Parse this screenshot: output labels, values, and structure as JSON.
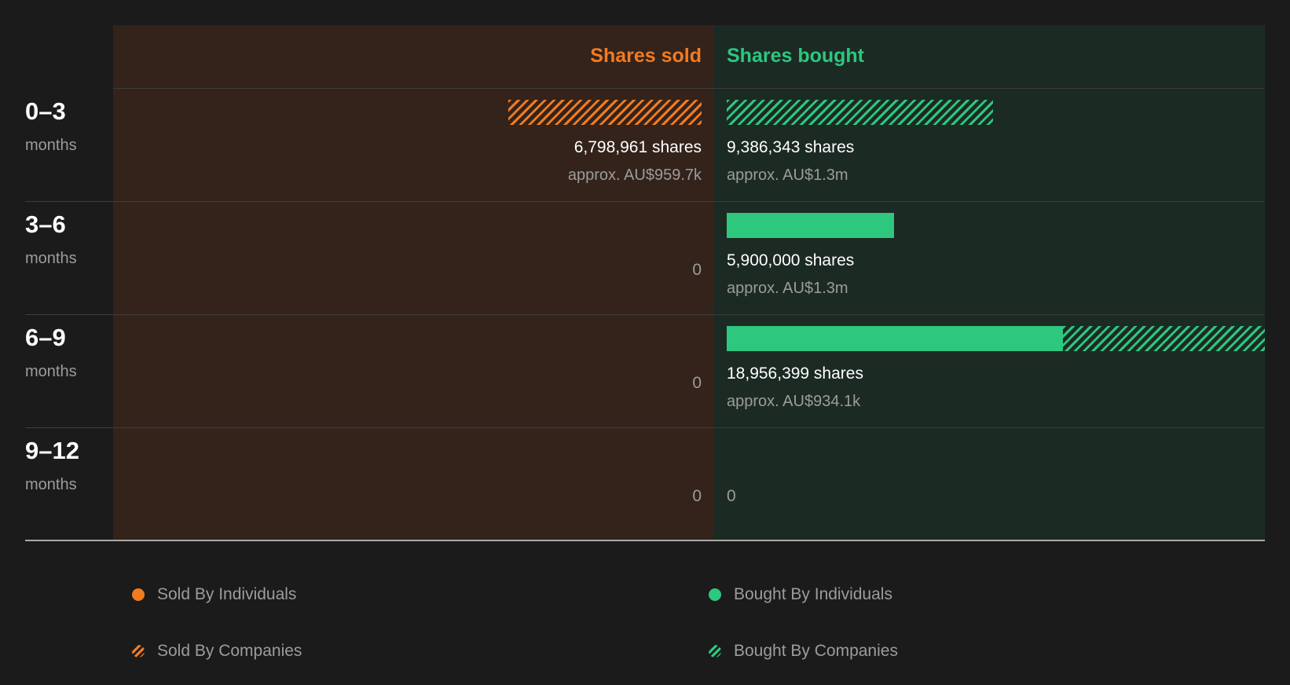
{
  "chart_data": {
    "type": "bar",
    "headers": {
      "sold": "Shares sold",
      "bought": "Shares bought"
    },
    "periods": [
      {
        "range": "0–3",
        "unit": "months",
        "sold": {
          "individuals": 0,
          "companies": 6798961,
          "shares_label": "6,798,961 shares",
          "approx": "approx. AU$959.7k",
          "zero_label": ""
        },
        "bought": {
          "individuals": 0,
          "companies": 9386343,
          "shares_label": "9,386,343 shares",
          "approx": "approx. AU$1.3m",
          "zero_label": ""
        }
      },
      {
        "range": "3–6",
        "unit": "months",
        "sold": {
          "individuals": 0,
          "companies": 0,
          "shares_label": "",
          "approx": "",
          "zero_label": "0"
        },
        "bought": {
          "individuals": 5900000,
          "companies": 0,
          "shares_label": "5,900,000 shares",
          "approx": "approx. AU$1.3m",
          "zero_label": ""
        }
      },
      {
        "range": "6–9",
        "unit": "months",
        "sold": {
          "individuals": 0,
          "companies": 0,
          "shares_label": "",
          "approx": "",
          "zero_label": "0"
        },
        "bought": {
          "individuals": 11850000,
          "companies": 7106399,
          "shares_label": "18,956,399 shares",
          "approx": "approx. AU$934.1k",
          "zero_label": ""
        }
      },
      {
        "range": "9–12",
        "unit": "months",
        "sold": {
          "individuals": 0,
          "companies": 0,
          "shares_label": "",
          "approx": "",
          "zero_label": "0"
        },
        "bought": {
          "individuals": 0,
          "companies": 0,
          "shares_label": "",
          "approx": "",
          "zero_label": "0"
        }
      }
    ],
    "max_value": 18956399,
    "legend": [
      {
        "label": "Sold By Individuals",
        "style": "solid",
        "side": "sold"
      },
      {
        "label": "Bought By Individuals",
        "style": "solid",
        "side": "bought"
      },
      {
        "label": "Sold By Companies",
        "style": "hatched",
        "side": "sold"
      },
      {
        "label": "Bought By Companies",
        "style": "hatched",
        "side": "bought"
      }
    ],
    "colors": {
      "sold": "#f27b21",
      "bought": "#2dc77e"
    }
  }
}
